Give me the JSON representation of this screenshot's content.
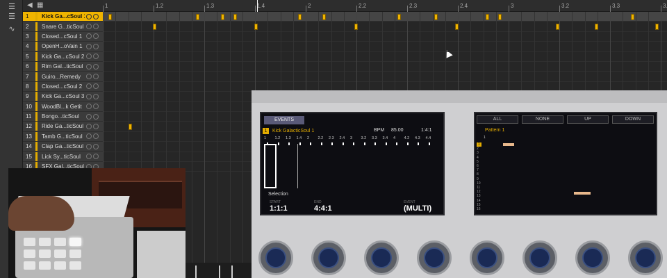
{
  "left_toolbar": {
    "icons": [
      "menu-icon",
      "list-icon",
      "waveform-icon"
    ]
  },
  "track_header": {
    "title": "",
    "icons": [
      "speaker-icon",
      "grid-icon"
    ]
  },
  "tracks": [
    {
      "num": "1",
      "name": "Kick Ga...cSoul 1",
      "selected": true
    },
    {
      "num": "2",
      "name": "Snare G...ticSoul",
      "selected": false
    },
    {
      "num": "3",
      "name": "Closed...cSoul 1",
      "selected": false
    },
    {
      "num": "4",
      "name": "OpenH...oVain 1",
      "selected": false
    },
    {
      "num": "5",
      "name": "Kick Ga...cSoul 2",
      "selected": false
    },
    {
      "num": "6",
      "name": "Rim Gal...ticSoul",
      "selected": false
    },
    {
      "num": "7",
      "name": "Guiro...Remedy",
      "selected": false
    },
    {
      "num": "8",
      "name": "Closed...cSoul 2",
      "selected": false
    },
    {
      "num": "9",
      "name": "Kick Ga...cSoul 3",
      "selected": false
    },
    {
      "num": "10",
      "name": "WoodBl...k Getit",
      "selected": false
    },
    {
      "num": "11",
      "name": "Bongo...ticSoul",
      "selected": false
    },
    {
      "num": "12",
      "name": "Ride Ga...ticSoul",
      "selected": false
    },
    {
      "num": "13",
      "name": "Tamb G...ticSoul",
      "selected": false
    },
    {
      "num": "14",
      "name": "Clap Ga...ticSoul",
      "selected": false
    },
    {
      "num": "15",
      "name": "Lick Sy...ticSoul",
      "selected": false
    },
    {
      "num": "16",
      "name": "SFX Gal...ticSoul",
      "selected": false
    }
  ],
  "ruler": {
    "labels": [
      "1",
      "1.2",
      "1.3",
      "1.4",
      "2",
      "2.2",
      "2.3",
      "2.4",
      "3",
      "3.2",
      "3.3",
      "3.4"
    ]
  },
  "hardware": {
    "left_screen": {
      "tab": "EVENTS",
      "track_index": "1",
      "track_name": "Kick GalacticSoul 1",
      "bpm_label": "BPM",
      "bpm_value": "85.00",
      "signature": "1:4:1",
      "ruler_labels": [
        "1",
        "1.2",
        "1.3",
        "1.4",
        "2",
        "2.2",
        "2.3",
        "2.4",
        "3",
        "3.2",
        "3.3",
        "3.4",
        "4",
        "4.2",
        "4.3",
        "4.4"
      ],
      "selection_label": "Selection",
      "start_caption": "START",
      "start_value": "1:1:1",
      "end_caption": "END",
      "end_value": "4:4:1",
      "event_caption": "EVENT",
      "event_value": "(MULTI)"
    },
    "right_screen": {
      "buttons": [
        "ALL",
        "NONE",
        "UP",
        "DOWN"
      ],
      "pattern_title": "Pattern 1",
      "ruler_first": "1",
      "pad_numbers": [
        "1",
        "2",
        "3",
        "4",
        "5",
        "6",
        "7",
        "8",
        "9",
        "10",
        "11",
        "12",
        "13",
        "14",
        "15",
        "16"
      ],
      "selected_pad": "1"
    }
  }
}
